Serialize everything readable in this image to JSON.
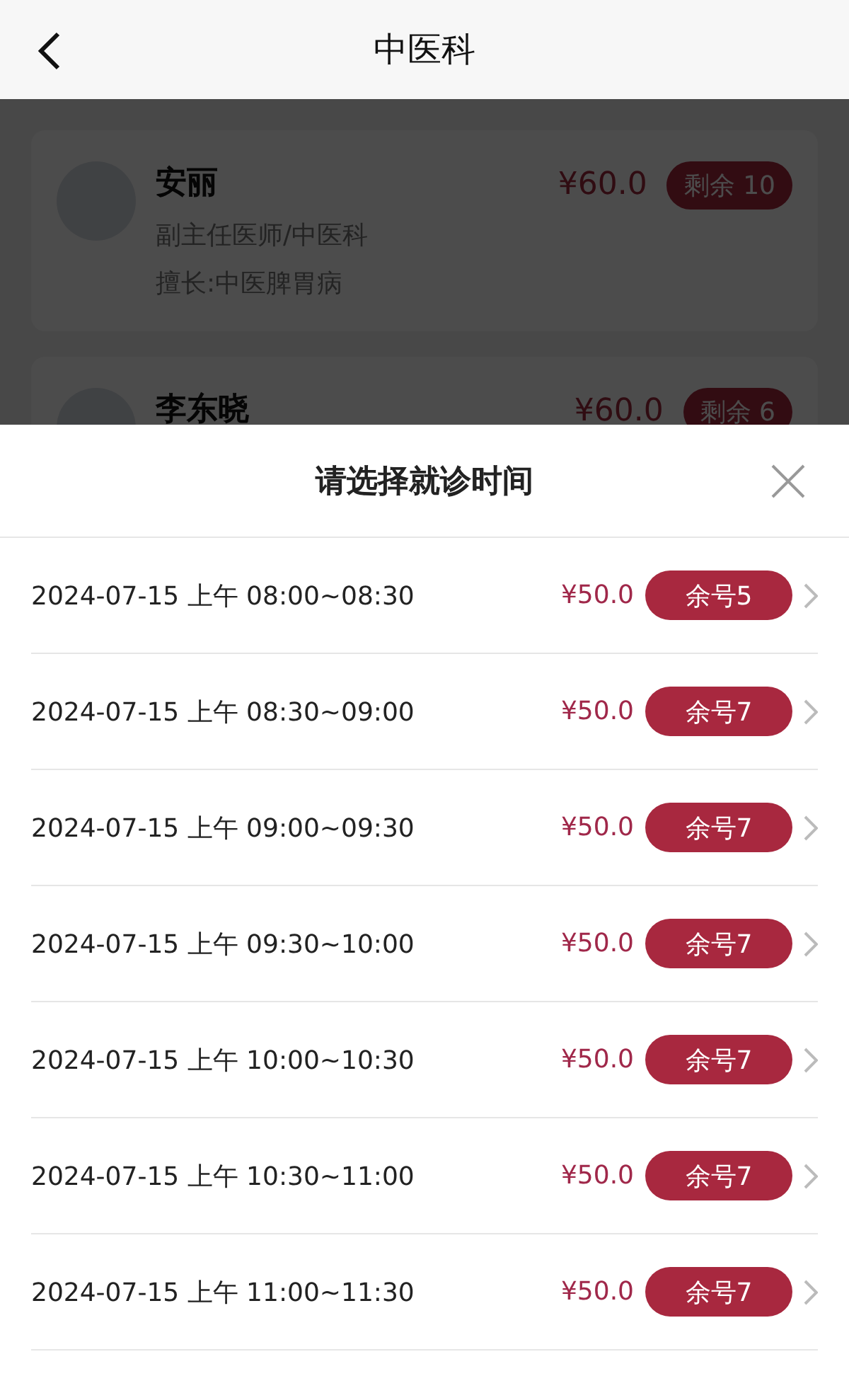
{
  "header": {
    "title": "中医科"
  },
  "doctors": [
    {
      "name": "安丽",
      "title": "副主任医师/中医科",
      "specialty": "擅长:中医脾胃病",
      "price": "¥60.0",
      "remaining": "剩余 10"
    },
    {
      "name": "李东晓",
      "price": "¥60.0",
      "remaining": "剩余 6"
    }
  ],
  "sheet": {
    "title": "请选择就诊时间",
    "slots": [
      {
        "time": "2024-07-15 上午 08:00~08:30",
        "price": "¥50.0",
        "remaining": "余号5"
      },
      {
        "time": "2024-07-15 上午 08:30~09:00",
        "price": "¥50.0",
        "remaining": "余号7"
      },
      {
        "time": "2024-07-15 上午 09:00~09:30",
        "price": "¥50.0",
        "remaining": "余号7"
      },
      {
        "time": "2024-07-15 上午 09:30~10:00",
        "price": "¥50.0",
        "remaining": "余号7"
      },
      {
        "time": "2024-07-15 上午 10:00~10:30",
        "price": "¥50.0",
        "remaining": "余号7"
      },
      {
        "time": "2024-07-15 上午 10:30~11:00",
        "price": "¥50.0",
        "remaining": "余号7"
      },
      {
        "time": "2024-07-15 上午 11:00~11:30",
        "price": "¥50.0",
        "remaining": "余号7"
      }
    ]
  }
}
